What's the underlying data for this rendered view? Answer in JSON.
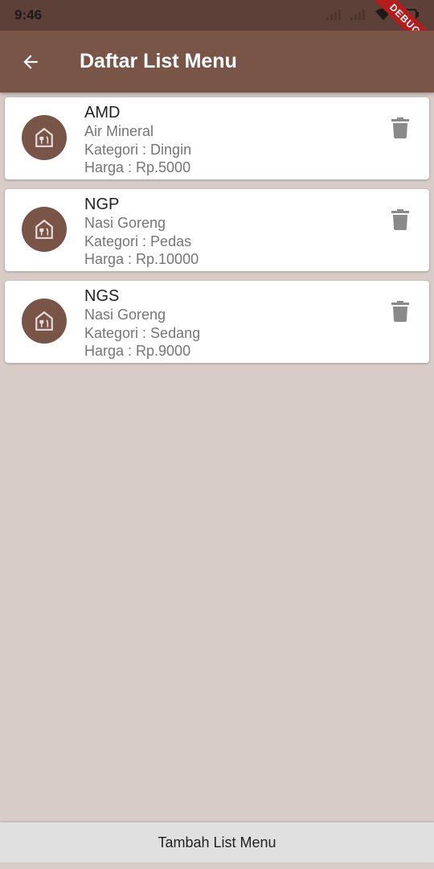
{
  "status_bar": {
    "time": "9:46"
  },
  "debug_banner": "DEBUG",
  "app_bar": {
    "title": "Daftar List Menu"
  },
  "menus": [
    {
      "code": "AMD",
      "name": "Air Mineral",
      "category": "Kategori : Dingin",
      "price": "Harga : Rp.5000"
    },
    {
      "code": "NGP",
      "name": "Nasi Goreng",
      "category": "Kategori : Pedas",
      "price": "Harga : Rp.10000"
    },
    {
      "code": "NGS",
      "name": "Nasi Goreng",
      "category": "Kategori : Sedang",
      "price": "Harga : Rp.9000"
    }
  ],
  "bottom_button": {
    "label": "Tambah List Menu"
  },
  "colors": {
    "primary": "#795548",
    "background": "#d7ccc8",
    "status_bar": "#5d4037"
  },
  "icons": {
    "back": "arrow-back-icon",
    "avatar": "restaurant-icon",
    "delete": "trash-icon"
  }
}
